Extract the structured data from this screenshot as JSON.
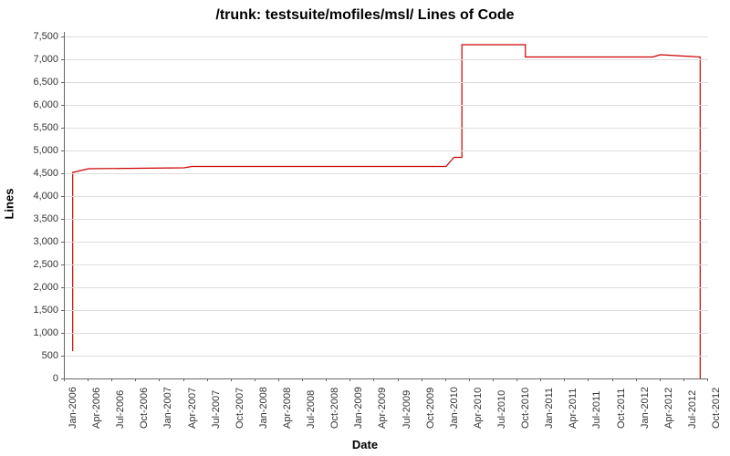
{
  "chart_data": {
    "type": "line",
    "title": "/trunk: testsuite/mofiles/msl/ Lines of Code",
    "xlabel": "Date",
    "ylabel": "Lines",
    "ylim": [
      0,
      7600
    ],
    "y_ticks": [
      0,
      500,
      1000,
      1500,
      2000,
      2500,
      3000,
      3500,
      4000,
      4500,
      5000,
      5500,
      6000,
      6500,
      7000,
      7500
    ],
    "x_ticks": [
      "Jan-2006",
      "Apr-2006",
      "Jul-2006",
      "Oct-2006",
      "Jan-2007",
      "Apr-2007",
      "Jul-2007",
      "Oct-2007",
      "Jan-2008",
      "Apr-2008",
      "Jul-2008",
      "Oct-2008",
      "Jan-2009",
      "Apr-2009",
      "Jul-2009",
      "Oct-2009",
      "Jan-2010",
      "Apr-2010",
      "Jul-2010",
      "Oct-2010",
      "Jan-2011",
      "Apr-2011",
      "Jul-2011",
      "Oct-2011",
      "Jan-2012",
      "Apr-2012",
      "Jul-2012",
      "Oct-2012"
    ],
    "series": [
      {
        "name": "lines-of-code",
        "color": "#cc0000",
        "points": [
          {
            "x": "Feb-2006",
            "y": 600
          },
          {
            "x": "Feb-2006",
            "y": 4520
          },
          {
            "x": "Apr-2006",
            "y": 4600
          },
          {
            "x": "Apr-2007",
            "y": 4620
          },
          {
            "x": "May-2007",
            "y": 4650
          },
          {
            "x": "Jan-2010",
            "y": 4650
          },
          {
            "x": "Feb-2010",
            "y": 4850
          },
          {
            "x": "Mar-2010",
            "y": 4850
          },
          {
            "x": "Mar-2010",
            "y": 7320
          },
          {
            "x": "Nov-2010",
            "y": 7320
          },
          {
            "x": "Nov-2010",
            "y": 7050
          },
          {
            "x": "Mar-2012",
            "y": 7050
          },
          {
            "x": "Apr-2012",
            "y": 7100
          },
          {
            "x": "Sep-2012",
            "y": 7050
          },
          {
            "x": "Sep-2012",
            "y": 0
          }
        ]
      }
    ]
  }
}
